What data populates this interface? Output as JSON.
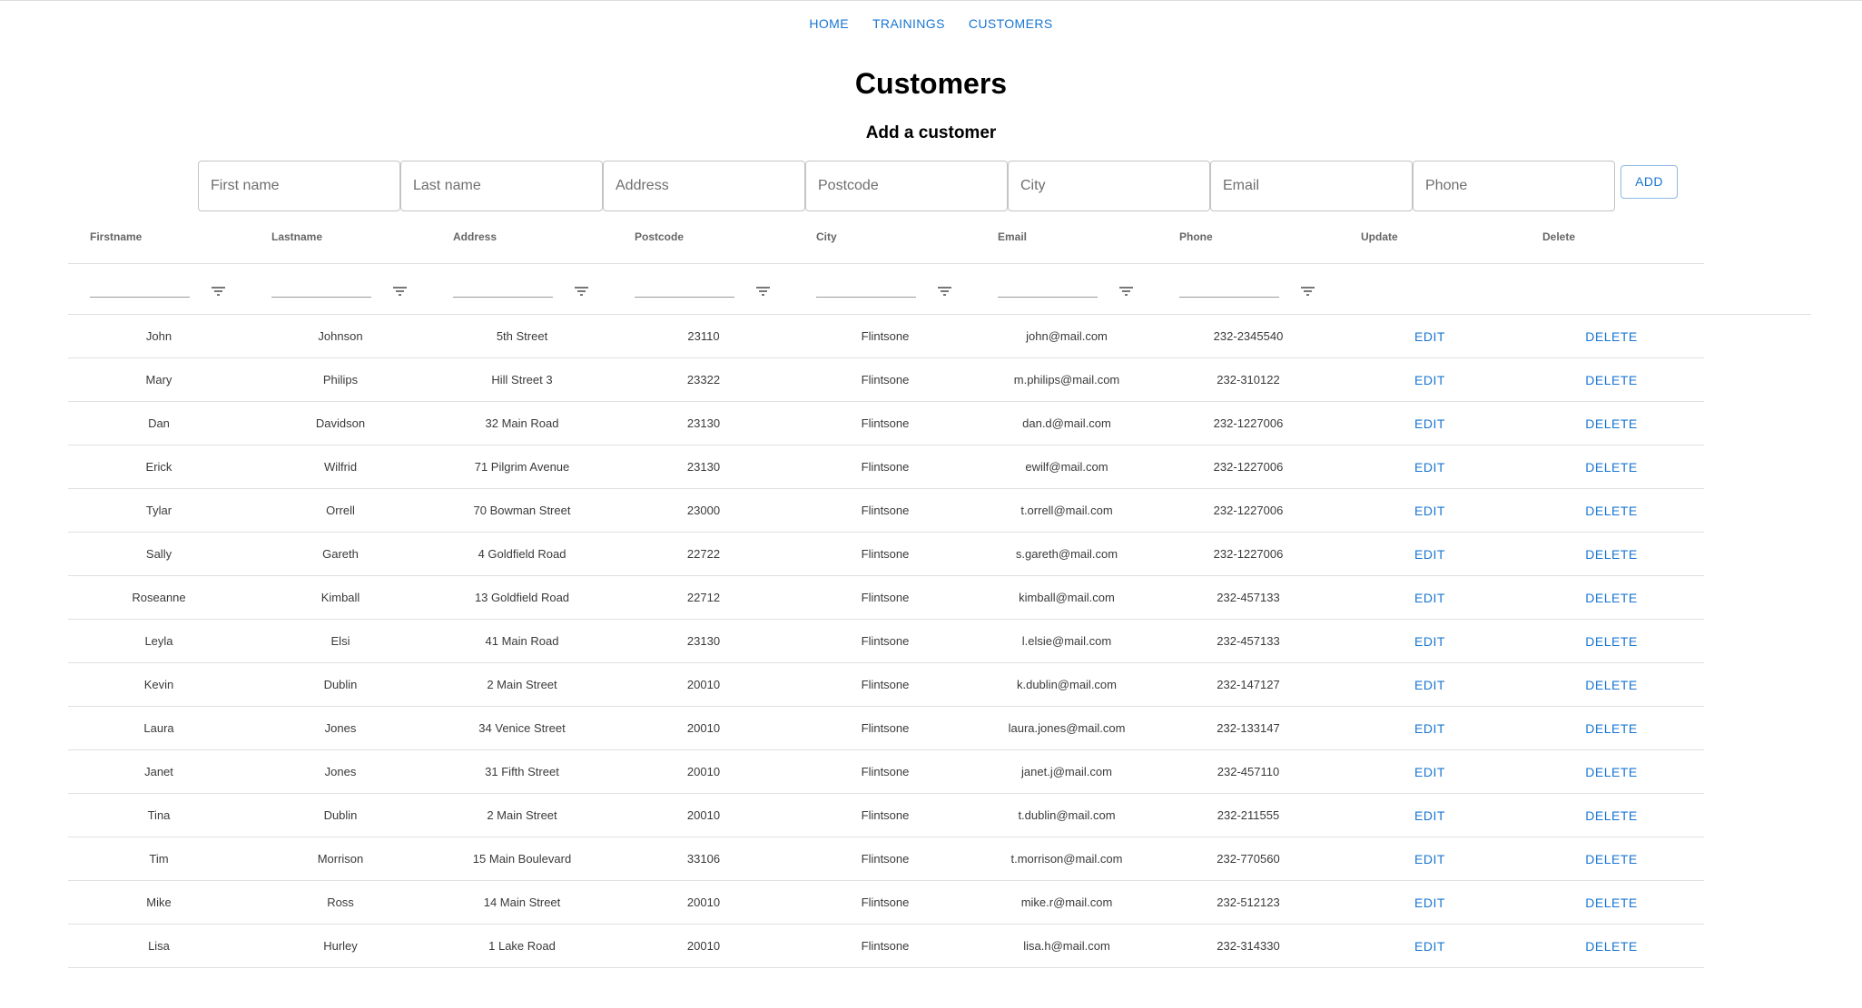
{
  "nav": {
    "items": [
      "HOME",
      "TRAININGS",
      "CUSTOMERS"
    ]
  },
  "page": {
    "title": "Customers",
    "subtitle": "Add a customer"
  },
  "form": {
    "placeholders": [
      "First name",
      "Last name",
      "Address",
      "Postcode",
      "City",
      "Email",
      "Phone"
    ],
    "add_label": "ADD"
  },
  "table": {
    "columns": [
      "Firstname",
      "Lastname",
      "Address",
      "Postcode",
      "City",
      "Email",
      "Phone",
      "Update",
      "Delete"
    ],
    "edit_label": "EDIT",
    "delete_label": "DELETE",
    "rows": [
      [
        "John",
        "Johnson",
        "5th Street",
        "23110",
        "Flintsone",
        "john@mail.com",
        "232-2345540"
      ],
      [
        "Mary",
        "Philips",
        "Hill Street 3",
        "23322",
        "Flintsone",
        "m.philips@mail.com",
        "232-310122"
      ],
      [
        "Dan",
        "Davidson",
        "32 Main Road",
        "23130",
        "Flintsone",
        "dan.d@mail.com",
        "232-1227006"
      ],
      [
        "Erick",
        "Wilfrid",
        "71 Pilgrim Avenue",
        "23130",
        "Flintsone",
        "ewilf@mail.com",
        "232-1227006"
      ],
      [
        "Tylar",
        "Orrell",
        "70 Bowman Street",
        "23000",
        "Flintsone",
        "t.orrell@mail.com",
        "232-1227006"
      ],
      [
        "Sally",
        "Gareth",
        "4 Goldfield Road",
        "22722",
        "Flintsone",
        "s.gareth@mail.com",
        "232-1227006"
      ],
      [
        "Roseanne",
        "Kimball",
        "13 Goldfield Road",
        "22712",
        "Flintsone",
        "kimball@mail.com",
        "232-457133"
      ],
      [
        "Leyla",
        "Elsi",
        "41 Main Road",
        "23130",
        "Flintsone",
        "l.elsie@mail.com",
        "232-457133"
      ],
      [
        "Kevin",
        "Dublin",
        "2 Main Street",
        "20010",
        "Flintsone",
        "k.dublin@mail.com",
        "232-147127"
      ],
      [
        "Laura",
        "Jones",
        "34 Venice Street",
        "20010",
        "Flintsone",
        "laura.jones@mail.com",
        "232-133147"
      ],
      [
        "Janet",
        "Jones",
        "31 Fifth Street",
        "20010",
        "Flintsone",
        "janet.j@mail.com",
        "232-457110"
      ],
      [
        "Tina",
        "Dublin",
        "2 Main Street",
        "20010",
        "Flintsone",
        "t.dublin@mail.com",
        "232-211555"
      ],
      [
        "Tim",
        "Morrison",
        "15 Main Boulevard",
        "33106",
        "Flintsone",
        "t.morrison@mail.com",
        "232-770560"
      ],
      [
        "Mike",
        "Ross",
        "14 Main Street",
        "20010",
        "Flintsone",
        "mike.r@mail.com",
        "232-512123"
      ],
      [
        "Lisa",
        "Hurley",
        "1 Lake Road",
        "20010",
        "Flintsone",
        "lisa.h@mail.com",
        "232-314330"
      ]
    ]
  },
  "colors": {
    "accent": "#1976d2",
    "border": "#e0e0e0",
    "header_text": "#666666"
  }
}
